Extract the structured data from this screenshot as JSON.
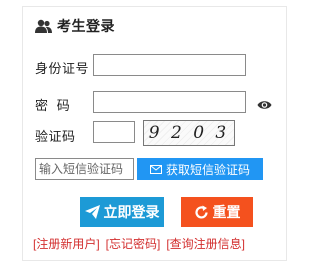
{
  "header": {
    "title": "考生登录"
  },
  "form": {
    "id_label": "身份证号",
    "id_value": "",
    "password_label": "密  码",
    "password_value": "",
    "captcha_label": "验证码",
    "captcha_value": "",
    "captcha_text": "9 2 0 3",
    "sms_placeholder": "输入短信验证码",
    "sms_button_label": "获取短信验证码"
  },
  "actions": {
    "login_label": "立即登录",
    "reset_label": "重置"
  },
  "links": [
    {
      "label": "[注册新用户]"
    },
    {
      "label": "[忘记密码]"
    },
    {
      "label": "[查询注册信息]"
    }
  ],
  "colors": {
    "sms_button": "#2196f3",
    "login_button": "#1d9ad6",
    "reset_button": "#f4511e",
    "link_text": "#d32f2f"
  }
}
